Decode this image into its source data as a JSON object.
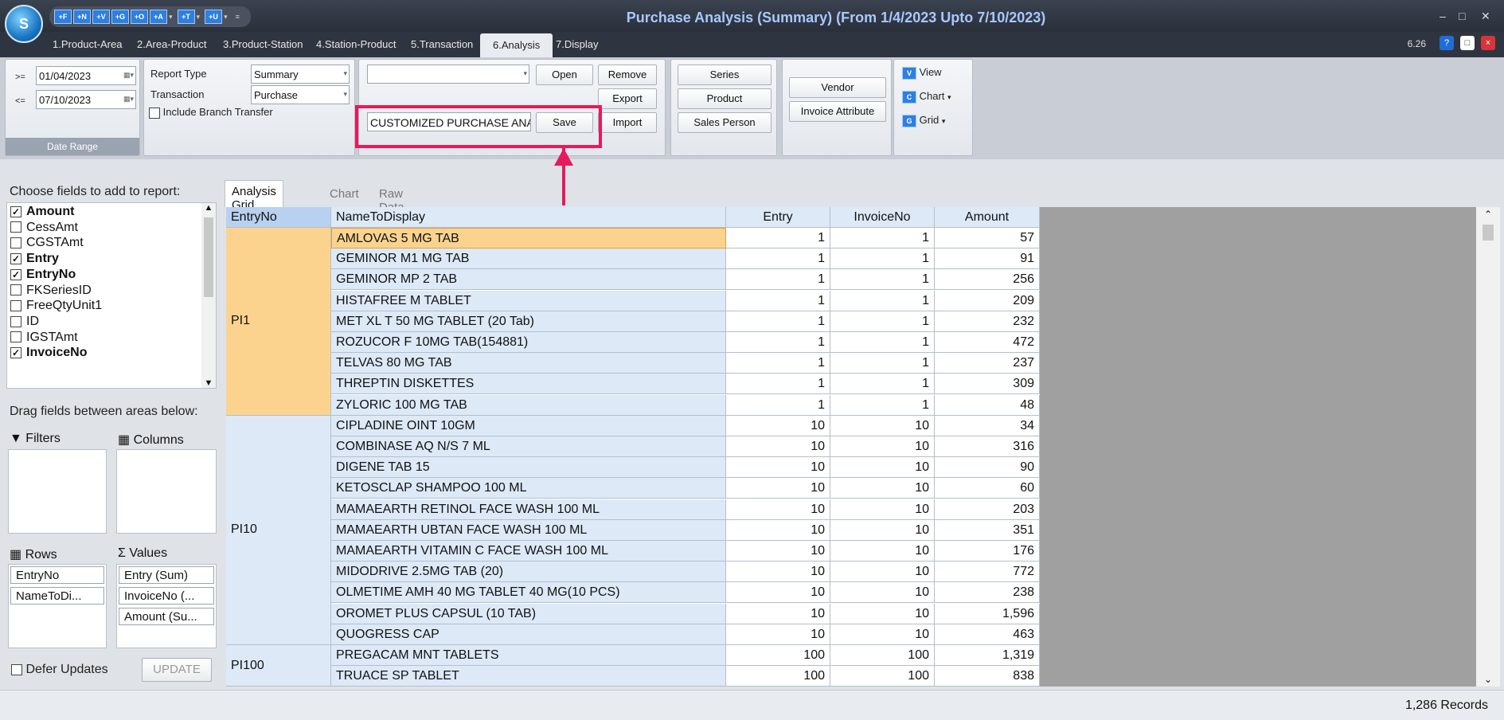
{
  "window": {
    "title": "Purchase Analysis (Summary) (From 1/4/2023 Upto 7/10/2023)",
    "version": "6.26",
    "logo_letter": "S"
  },
  "qat_buttons": [
    "+F",
    "+N",
    "+V",
    "+G",
    "+O",
    "+A",
    "+T",
    "+U"
  ],
  "ribbon_tabs": [
    "1.Product-Area",
    "2.Area-Product",
    "3.Product-Station",
    "4.Station-Product",
    "5.Transaction",
    "6.Analysis",
    "7.Display"
  ],
  "date_range": {
    "from_op": ">=",
    "from": "01/04/2023",
    "to_op": "<=",
    "to": "07/10/2023",
    "group_label": "Date Range"
  },
  "report": {
    "type_label": "Report Type",
    "type_value": "Summary",
    "transaction_label": "Transaction",
    "transaction_value": "Purchase",
    "branch_label": "Include Branch Transfer"
  },
  "layout": {
    "preset_value": "",
    "name_value": "CUSTOMIZED PURCHASE ANAL",
    "open": "Open",
    "remove": "Remove",
    "export": "Export",
    "save": "Save",
    "import": "Import"
  },
  "filters_group": {
    "series": "Series",
    "product": "Product",
    "sales_person": "Sales Person",
    "vendor": "Vendor",
    "invoice_attr": "Invoice Attribute"
  },
  "view_group": {
    "view": "View",
    "chart": "Chart",
    "grid": "Grid"
  },
  "field_chooser": {
    "title": "Choose fields to add to report:",
    "fields": [
      {
        "name": "Amount",
        "checked": true
      },
      {
        "name": "CessAmt",
        "checked": false
      },
      {
        "name": "CGSTAmt",
        "checked": false
      },
      {
        "name": "Entry",
        "checked": true
      },
      {
        "name": "EntryNo",
        "checked": true
      },
      {
        "name": "FKSeriesID",
        "checked": false
      },
      {
        "name": "FreeQtyUnit1",
        "checked": false
      },
      {
        "name": "ID",
        "checked": false
      },
      {
        "name": "IGSTAmt",
        "checked": false
      },
      {
        "name": "InvoiceNo",
        "checked": true
      }
    ],
    "drag_label": "Drag fields between areas below:",
    "filters_label": "Filters",
    "columns_label": "Columns",
    "rows_label": "Rows",
    "values_label": "Values",
    "rows": [
      "EntryNo",
      "NameToDi..."
    ],
    "values": [
      "Entry (Sum)",
      "InvoiceNo (...",
      "Amount (Su..."
    ],
    "defer_label": "Defer Updates",
    "update_button": "UPDATE"
  },
  "grid_tabs": [
    "Analysis Grid",
    "Chart",
    "Raw Data"
  ],
  "grid": {
    "headers": [
      "EntryNo",
      "NameToDisplay",
      "Entry",
      "InvoiceNo",
      "Amount"
    ],
    "groups": [
      {
        "entry": "PI1",
        "rows": [
          {
            "name": "AMLOVAS 5 MG TAB",
            "entry": "1",
            "invoice": "1",
            "amount": "57"
          },
          {
            "name": "GEMINOR M1 MG TAB",
            "entry": "1",
            "invoice": "1",
            "amount": "91"
          },
          {
            "name": "GEMINOR MP 2 TAB",
            "entry": "1",
            "invoice": "1",
            "amount": "256"
          },
          {
            "name": "HISTAFREE M TABLET",
            "entry": "1",
            "invoice": "1",
            "amount": "209"
          },
          {
            "name": "MET XL T 50 MG TABLET (20 Tab)",
            "entry": "1",
            "invoice": "1",
            "amount": "232"
          },
          {
            "name": "ROZUCOR F 10MG TAB(154881)",
            "entry": "1",
            "invoice": "1",
            "amount": "472"
          },
          {
            "name": "TELVAS 80 MG TAB",
            "entry": "1",
            "invoice": "1",
            "amount": "237"
          },
          {
            "name": "THREPTIN DISKETTES",
            "entry": "1",
            "invoice": "1",
            "amount": "309"
          },
          {
            "name": "ZYLORIC 100 MG TAB",
            "entry": "1",
            "invoice": "1",
            "amount": "48"
          }
        ]
      },
      {
        "entry": "PI10",
        "rows": [
          {
            "name": "CIPLADINE OINT 10GM",
            "entry": "10",
            "invoice": "10",
            "amount": "34"
          },
          {
            "name": "COMBINASE AQ N/S 7 ML",
            "entry": "10",
            "invoice": "10",
            "amount": "316"
          },
          {
            "name": "DIGENE TAB 15",
            "entry": "10",
            "invoice": "10",
            "amount": "90"
          },
          {
            "name": "KETOSCLAP SHAMPOO 100 ML",
            "entry": "10",
            "invoice": "10",
            "amount": "60"
          },
          {
            "name": "MAMAEARTH RETINOL FACE WASH 100 ML",
            "entry": "10",
            "invoice": "10",
            "amount": "203"
          },
          {
            "name": "MAMAEARTH UBTAN FACE WASH 100 ML",
            "entry": "10",
            "invoice": "10",
            "amount": "351"
          },
          {
            "name": "MAMAEARTH VITAMIN C FACE WASH 100 ML",
            "entry": "10",
            "invoice": "10",
            "amount": "176"
          },
          {
            "name": "MIDODRIVE 2.5MG TAB (20)",
            "entry": "10",
            "invoice": "10",
            "amount": "772"
          },
          {
            "name": "OLMETIME AMH 40 MG TABLET 40 MG(10 PCS)",
            "entry": "10",
            "invoice": "10",
            "amount": "238"
          },
          {
            "name": "OROMET PLUS CAPSUL (10 TAB)",
            "entry": "10",
            "invoice": "10",
            "amount": "1,596"
          },
          {
            "name": "QUOGRESS CAP",
            "entry": "10",
            "invoice": "10",
            "amount": "463"
          }
        ]
      },
      {
        "entry": "PI100",
        "rows": [
          {
            "name": "PREGACAM MNT  TABLETS",
            "entry": "100",
            "invoice": "100",
            "amount": "1,319"
          },
          {
            "name": "TRUACE SP  TABLET",
            "entry": "100",
            "invoice": "100",
            "amount": "838"
          }
        ]
      }
    ]
  },
  "status": {
    "records": "1,286 Records"
  },
  "colors": {
    "highlight": "#e8195a",
    "selected_row": "#fbd38f",
    "header_bg": "#dde9f7"
  }
}
